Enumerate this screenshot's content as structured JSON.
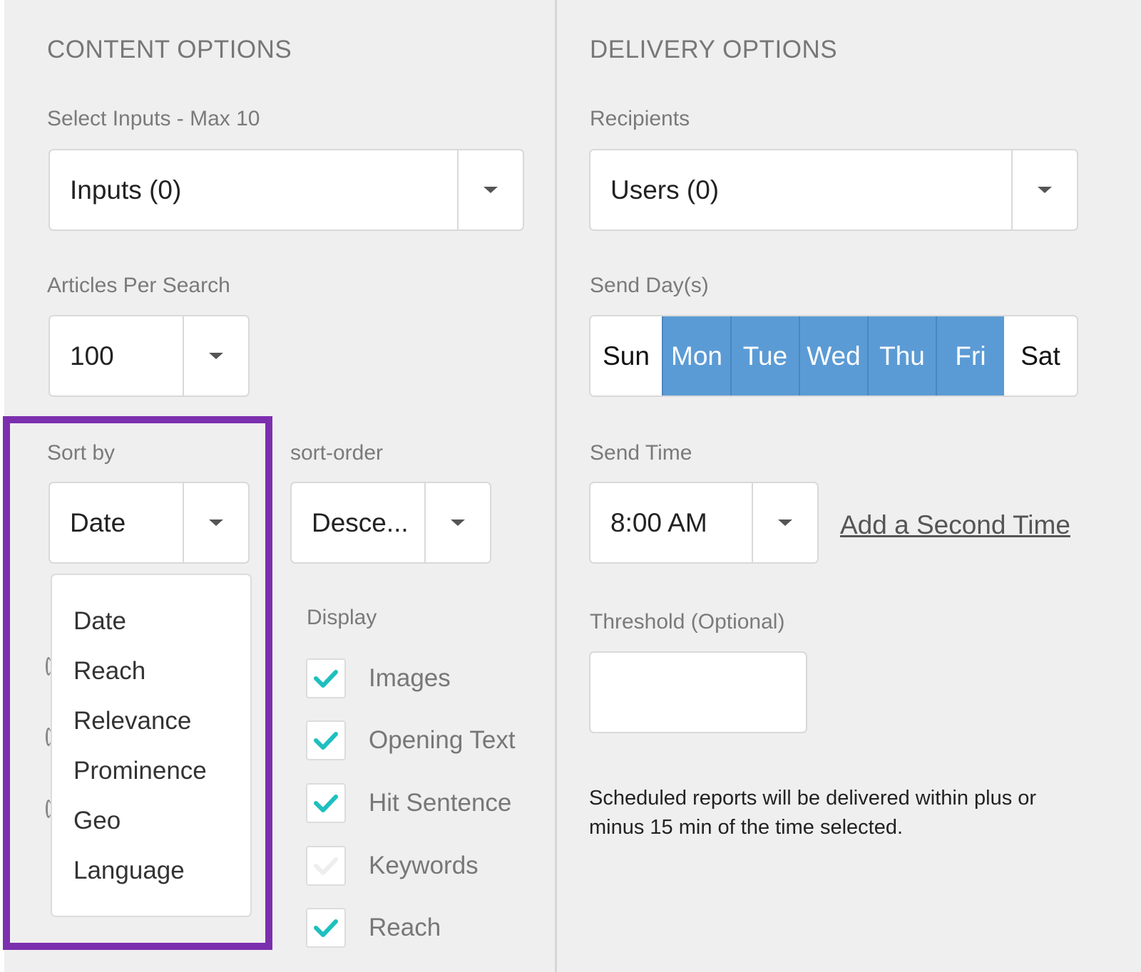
{
  "content": {
    "heading": "CONTENT OPTIONS",
    "inputs": {
      "label": "Select Inputs - Max 10",
      "value": "Inputs (0)"
    },
    "articles": {
      "label": "Articles Per Search",
      "value": "100"
    },
    "sort_by": {
      "label": "Sort by",
      "value": "Date",
      "options": [
        "Date",
        "Reach",
        "Relevance",
        "Prominence",
        "Geo",
        "Language"
      ]
    },
    "sort_order": {
      "label": "sort-order",
      "value": "Desce..."
    },
    "display": {
      "label": "Display",
      "items": [
        {
          "label": "Images",
          "checked": true
        },
        {
          "label": "Opening Text",
          "checked": true
        },
        {
          "label": "Hit Sentence",
          "checked": true
        },
        {
          "label": "Keywords",
          "checked": false
        },
        {
          "label": "Reach",
          "checked": true
        }
      ]
    }
  },
  "delivery": {
    "heading": "DELIVERY OPTIONS",
    "recipients": {
      "label": "Recipients",
      "value": "Users (0)"
    },
    "send_days": {
      "label": "Send Day(s)",
      "days": [
        {
          "label": "Sun",
          "selected": false
        },
        {
          "label": "Mon",
          "selected": true
        },
        {
          "label": "Tue",
          "selected": true
        },
        {
          "label": "Wed",
          "selected": true
        },
        {
          "label": "Thu",
          "selected": true
        },
        {
          "label": "Fri",
          "selected": true
        },
        {
          "label": "Sat",
          "selected": false
        }
      ]
    },
    "send_time": {
      "label": "Send Time",
      "value": "8:00 AM",
      "add_link": "Add a Second Time"
    },
    "threshold": {
      "label": "Threshold (Optional)",
      "value": ""
    },
    "note": "Scheduled reports will be delivered within plus or minus 15 min of the time selected."
  },
  "colors": {
    "day_selected": "#5b9bd5",
    "check": "#1fbfbf",
    "highlight": "#7b2fae"
  }
}
